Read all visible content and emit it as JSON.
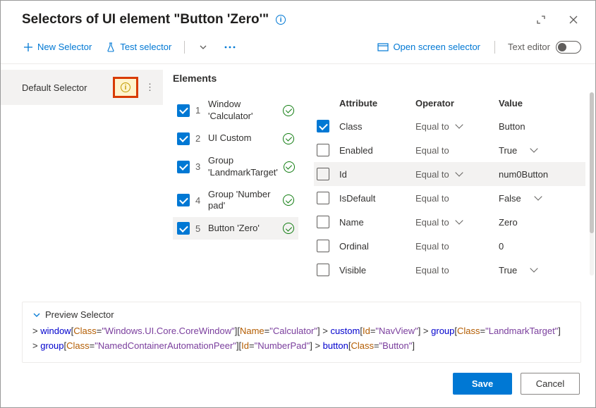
{
  "header": {
    "title": "Selectors of UI element \"Button 'Zero'\""
  },
  "toolbar": {
    "new_selector": "New Selector",
    "test_selector": "Test selector",
    "open_screen_selector": "Open screen selector",
    "text_editor": "Text editor"
  },
  "sidebar": {
    "default_selector": "Default Selector"
  },
  "elements": {
    "title": "Elements",
    "items": [
      {
        "idx": "1",
        "label": "Window 'Calculator'",
        "checked": true,
        "selected": false
      },
      {
        "idx": "2",
        "label": "UI Custom",
        "checked": true,
        "selected": false
      },
      {
        "idx": "3",
        "label": "Group 'LandmarkTarget'",
        "checked": true,
        "selected": false
      },
      {
        "idx": "4",
        "label": "Group 'Number pad'",
        "checked": true,
        "selected": false
      },
      {
        "idx": "5",
        "label": "Button 'Zero'",
        "checked": true,
        "selected": true
      }
    ]
  },
  "attributes": {
    "col_attribute": "Attribute",
    "col_operator": "Operator",
    "col_value": "Value",
    "rows": [
      {
        "checked": true,
        "name": "Class",
        "op": "Equal to",
        "op_chev": true,
        "value": "Button",
        "val_chev": false,
        "hl": false
      },
      {
        "checked": false,
        "name": "Enabled",
        "op": "Equal to",
        "op_chev": false,
        "value": "True",
        "val_chev": true,
        "hl": false
      },
      {
        "checked": false,
        "name": "Id",
        "op": "Equal to",
        "op_chev": true,
        "value": "num0Button",
        "val_chev": false,
        "hl": true
      },
      {
        "checked": false,
        "name": "IsDefault",
        "op": "Equal to",
        "op_chev": false,
        "value": "False",
        "val_chev": true,
        "hl": false
      },
      {
        "checked": false,
        "name": "Name",
        "op": "Equal to",
        "op_chev": true,
        "value": "Zero",
        "val_chev": false,
        "hl": false
      },
      {
        "checked": false,
        "name": "Ordinal",
        "op": "Equal to",
        "op_chev": false,
        "value": "0",
        "val_chev": false,
        "hl": false
      },
      {
        "checked": false,
        "name": "Visible",
        "op": "Equal to",
        "op_chev": false,
        "value": "True",
        "val_chev": true,
        "hl": false
      }
    ]
  },
  "preview": {
    "label": "Preview Selector",
    "tokens": [
      {
        "t": "> ",
        "c": "punc"
      },
      {
        "t": "window",
        "c": "tag"
      },
      {
        "t": "[",
        "c": "punc"
      },
      {
        "t": "Class",
        "c": "attr"
      },
      {
        "t": "=",
        "c": "punc"
      },
      {
        "t": "\"Windows.UI.Core.CoreWindow\"",
        "c": "str"
      },
      {
        "t": "][",
        "c": "punc"
      },
      {
        "t": "Name",
        "c": "attr"
      },
      {
        "t": "=",
        "c": "punc"
      },
      {
        "t": "\"Calculator\"",
        "c": "str"
      },
      {
        "t": "] > ",
        "c": "punc"
      },
      {
        "t": "custom",
        "c": "tag"
      },
      {
        "t": "[",
        "c": "punc"
      },
      {
        "t": "Id",
        "c": "attr"
      },
      {
        "t": "=",
        "c": "punc"
      },
      {
        "t": "\"NavView\"",
        "c": "str"
      },
      {
        "t": "] > ",
        "c": "punc"
      },
      {
        "t": "group",
        "c": "tag"
      },
      {
        "t": "[",
        "c": "punc"
      },
      {
        "t": "Class",
        "c": "attr"
      },
      {
        "t": "=",
        "c": "punc"
      },
      {
        "t": "\"LandmarkTarget\"",
        "c": "str"
      },
      {
        "t": "]",
        "c": "punc"
      },
      {
        "br": true
      },
      {
        "t": "> ",
        "c": "punc"
      },
      {
        "t": "group",
        "c": "tag"
      },
      {
        "t": "[",
        "c": "punc"
      },
      {
        "t": "Class",
        "c": "attr"
      },
      {
        "t": "=",
        "c": "punc"
      },
      {
        "t": "\"NamedContainerAutomationPeer\"",
        "c": "str"
      },
      {
        "t": "][",
        "c": "punc"
      },
      {
        "t": "Id",
        "c": "attr"
      },
      {
        "t": "=",
        "c": "punc"
      },
      {
        "t": "\"NumberPad\"",
        "c": "str"
      },
      {
        "t": "] > ",
        "c": "punc"
      },
      {
        "t": "button",
        "c": "tag"
      },
      {
        "t": "[",
        "c": "punc"
      },
      {
        "t": "Class",
        "c": "attr"
      },
      {
        "t": "=",
        "c": "punc"
      },
      {
        "t": "\"Button\"",
        "c": "str"
      },
      {
        "t": "]",
        "c": "punc"
      }
    ]
  },
  "footer": {
    "save": "Save",
    "cancel": "Cancel"
  }
}
